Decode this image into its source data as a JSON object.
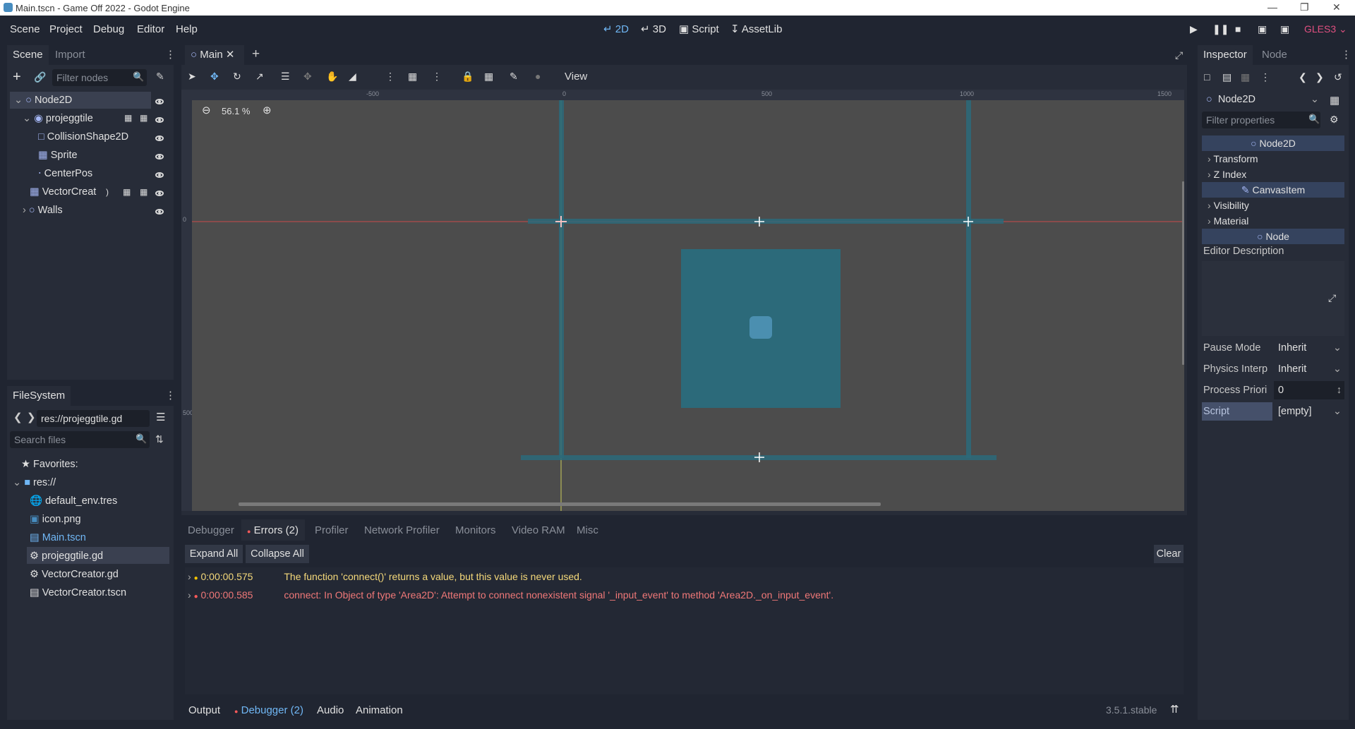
{
  "window": {
    "title": "Main.tscn - Game Off 2022 - Godot Engine"
  },
  "menu": [
    "Scene",
    "Project",
    "Debug",
    "Editor",
    "Help"
  ],
  "workspaces": {
    "w2d": "2D",
    "w3d": "3D",
    "script": "Script",
    "assetlib": "AssetLib"
  },
  "renderer": "GLES3",
  "scene_dock": {
    "tabs": [
      "Scene",
      "Import"
    ],
    "filter_placeholder": "Filter nodes",
    "nodes": [
      {
        "label": "Node2D",
        "icon": "node2d-icon"
      },
      {
        "label": "projeggtile",
        "icon": "area2d-icon"
      },
      {
        "label": "CollisionShape2D",
        "icon": "collision-shape-icon"
      },
      {
        "label": "Sprite",
        "icon": "sprite-icon"
      },
      {
        "label": "CenterPos",
        "icon": "position2d-icon"
      },
      {
        "label": "VectorCreat",
        "icon": "vector-creator-icon"
      },
      {
        "label": "Walls",
        "icon": "node2d-icon"
      }
    ]
  },
  "filesystem": {
    "title": "FileSystem",
    "path": "res://projeggtile.gd",
    "search_placeholder": "Search files",
    "favorites": "Favorites:",
    "root": "res://",
    "files": [
      "default_env.tres",
      "icon.png",
      "Main.tscn",
      "projeggtile.gd",
      "VectorCreator.gd",
      "VectorCreator.tscn"
    ]
  },
  "editor_tab": {
    "label": "Main"
  },
  "toolbar": {
    "view": "View",
    "zoom": "56.1 %"
  },
  "ruler": {
    "h": [
      "-500",
      "0",
      "500",
      "1000",
      "1500"
    ],
    "v": [
      "0",
      "500"
    ]
  },
  "debugger": {
    "tabs": [
      "Debugger",
      "Errors (2)",
      "Profiler",
      "Network Profiler",
      "Monitors",
      "Video RAM",
      "Misc"
    ],
    "expand_all": "Expand All",
    "collapse_all": "Collapse All",
    "clear": "Clear",
    "errors": [
      {
        "time": "0:00:00.575",
        "message": "The function 'connect()' returns a value, but this value is never used.",
        "color": "#f5d97a",
        "dot": "#f5c400"
      },
      {
        "time": "0:00:00.585",
        "message": "connect: In Object of type 'Area2D': Attempt to connect nonexistent signal '_input_event' to method 'Area2D._on_input_event'.",
        "color": "#f07878",
        "dot": "#ff5a5a"
      }
    ]
  },
  "bottom_panel": {
    "tabs": [
      "Output",
      "Debugger (2)",
      "Audio",
      "Animation"
    ],
    "version": "3.5.1.stable"
  },
  "inspector": {
    "tabs": [
      "Inspector",
      "Node"
    ],
    "node": "Node2D",
    "filter_placeholder": "Filter properties",
    "sections": [
      {
        "label": "Node2D",
        "kind": "class"
      },
      {
        "label": "Transform",
        "kind": "group"
      },
      {
        "label": "Z Index",
        "kind": "group"
      },
      {
        "label": "CanvasItem",
        "kind": "class"
      },
      {
        "label": "Visibility",
        "kind": "group"
      },
      {
        "label": "Material",
        "kind": "group"
      },
      {
        "label": "Node",
        "kind": "class"
      }
    ],
    "editor_description": "Editor Description",
    "props": [
      {
        "label": "Pause Mode",
        "value": "Inherit"
      },
      {
        "label": "Physics Interp",
        "value": "Inherit"
      },
      {
        "label": "Process Priori",
        "value": "0"
      },
      {
        "label": "Script",
        "value": "[empty]"
      }
    ]
  },
  "colors": {
    "accent": "#70b7f5",
    "panel": "#272c38",
    "bg": "#202531",
    "viewport": "#4c4c4c",
    "teal": "#2c6a7a"
  }
}
